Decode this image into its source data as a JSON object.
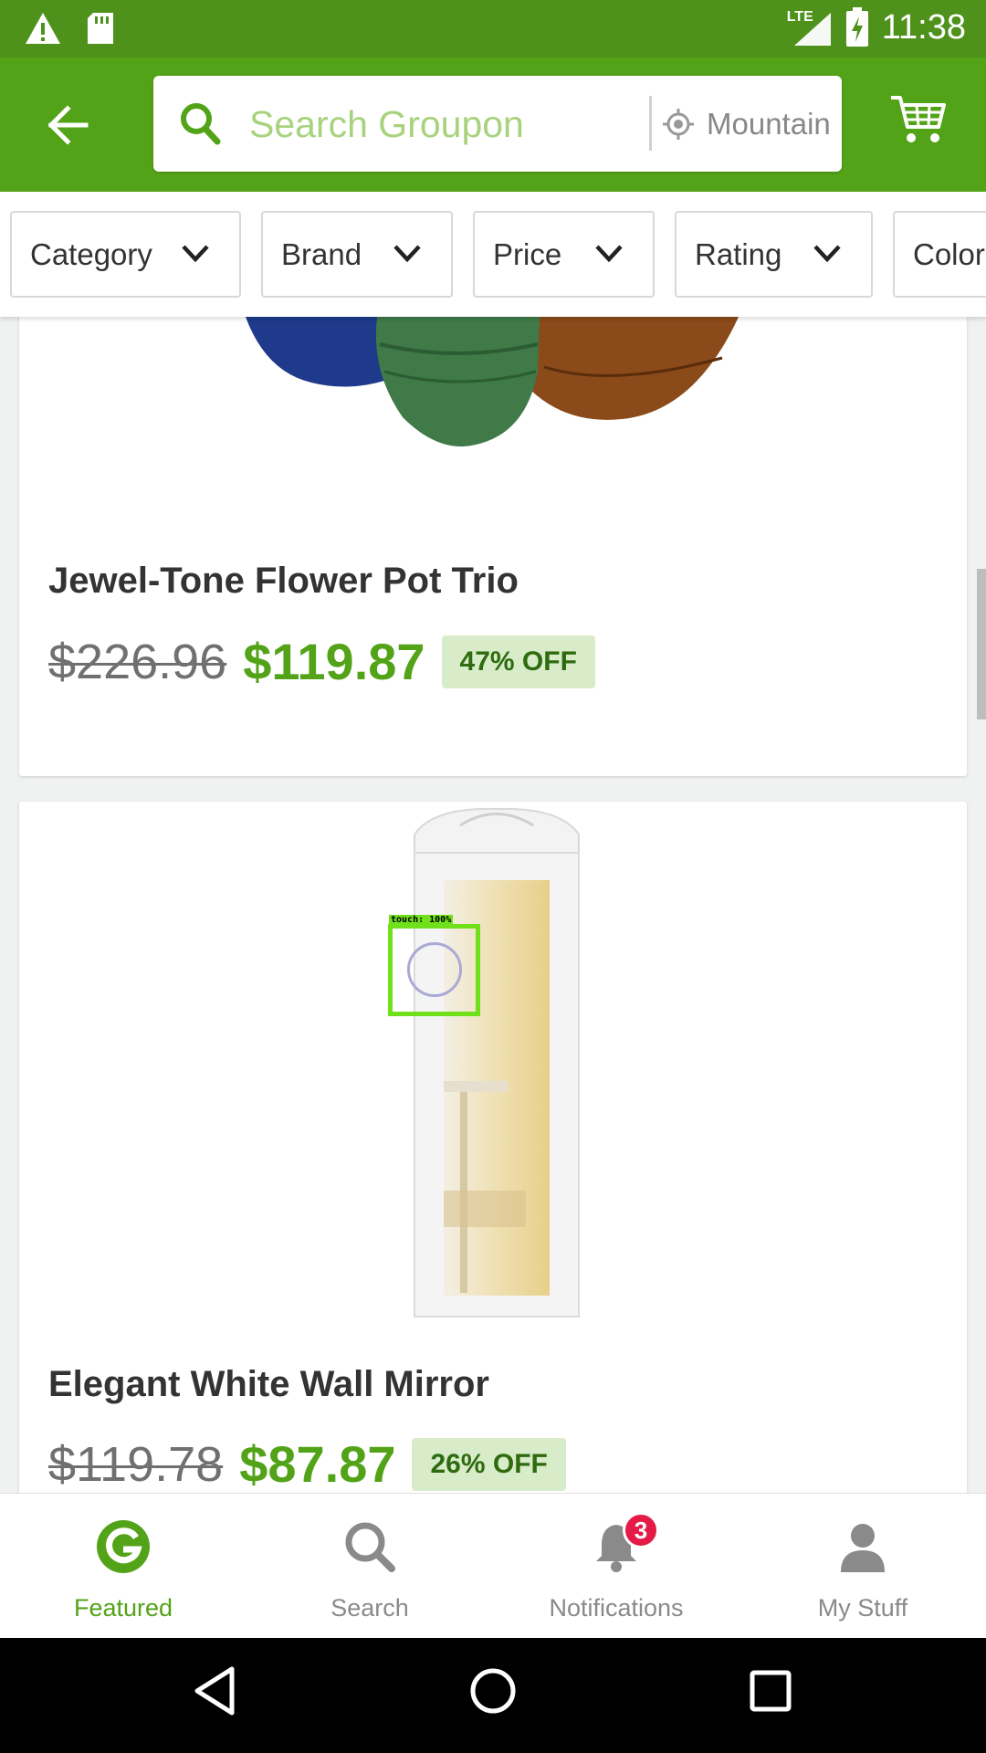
{
  "status_bar": {
    "time": "11:38",
    "network": "LTE",
    "icons": [
      "warning-icon",
      "sd-card-icon",
      "signal-icon",
      "battery-charging-icon"
    ]
  },
  "header": {
    "back_icon": "arrow-left-icon",
    "search": {
      "placeholder": "Search Groupon",
      "location": "Mountain View"
    },
    "cart_icon": "shopping-cart-icon"
  },
  "filters": [
    {
      "label": "Category"
    },
    {
      "label": "Brand"
    },
    {
      "label": "Price"
    },
    {
      "label": "Rating"
    },
    {
      "label": "Color"
    }
  ],
  "products": [
    {
      "title": "Jewel-Tone Flower Pot Trio",
      "old_price": "$226.96",
      "new_price": "$119.87",
      "discount": "47% OFF"
    },
    {
      "title": "Elegant White Wall Mirror",
      "old_price": "$119.78",
      "new_price": "$87.87",
      "discount": "26% OFF"
    }
  ],
  "touch_overlay": {
    "label": "touch: 100%"
  },
  "bottom_nav": {
    "items": [
      {
        "label": "Featured",
        "icon": "groupon-g-icon",
        "active": true
      },
      {
        "label": "Search",
        "icon": "search-icon",
        "active": false
      },
      {
        "label": "Notifications",
        "icon": "bell-icon",
        "active": false,
        "badge": "3"
      },
      {
        "label": "My Stuff",
        "icon": "person-icon",
        "active": false
      }
    ]
  },
  "colors": {
    "brand_green": "#53a318",
    "status_green": "#4f921b",
    "badge_red": "#e31b46"
  }
}
